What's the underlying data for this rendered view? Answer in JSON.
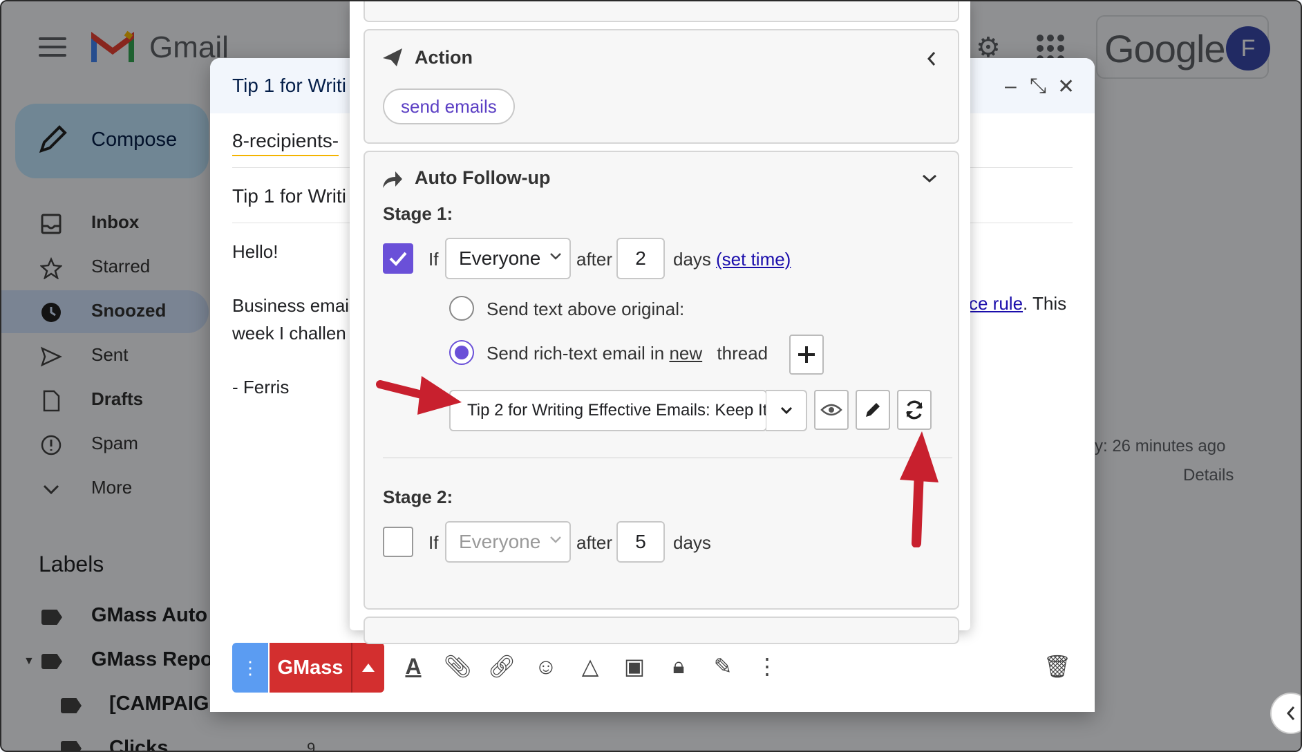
{
  "gmail": {
    "logo_text": "Gmail",
    "google_text": "Google",
    "avatar_letter": "F",
    "compose_label": "Compose",
    "nav": [
      {
        "label": "Inbox"
      },
      {
        "label": "Starred"
      },
      {
        "label": "Snoozed"
      },
      {
        "label": "Sent"
      },
      {
        "label": "Drafts"
      },
      {
        "label": "Spam"
      },
      {
        "label": "More"
      }
    ],
    "labels_heading": "Labels",
    "labels": [
      {
        "label": "GMass Auto"
      },
      {
        "label": "GMass Repo"
      },
      {
        "label": "[CAMPAIG"
      },
      {
        "label": "Clicks"
      }
    ],
    "clicks_count": "9",
    "activity_text": "ity: 26 minutes ago",
    "details_text": "Details"
  },
  "compose": {
    "title": "Tip 1 for Writi",
    "to": "8-recipients-",
    "subject": "Tip 1 for Writi",
    "greeting": "Hello!",
    "line1": "Business emai",
    "line2": "week I challen",
    "signature": "- Ferris",
    "right_link": "ce rule",
    "right_after": ". This",
    "gmass_label": "GMass"
  },
  "panel": {
    "action": {
      "title": "Action",
      "pill": "send emails"
    },
    "followup": {
      "title": "Auto Follow-up",
      "stage1": {
        "label": "Stage 1:",
        "checked": true,
        "if_text": "If",
        "audience": "Everyone",
        "after_text": "after",
        "days_value": "2",
        "days_text": "days",
        "set_time": "(set time)",
        "option_above": "Send text above original:",
        "option_new_prefix": "Send rich-text email in",
        "option_new_word": "new",
        "option_new_suffix": "thread",
        "template": "Tip 2 for Writing Effective Emails: Keep It"
      },
      "stage2": {
        "label": "Stage 2:",
        "checked": false,
        "if_text": "If",
        "audience": "Everyone",
        "after_text": "after",
        "days_value": "5",
        "days_text": "days"
      }
    }
  },
  "colors": {
    "accent_purple": "#6a50d8",
    "gmass_red": "#d32f2f",
    "arrow_red": "#c8202e"
  }
}
